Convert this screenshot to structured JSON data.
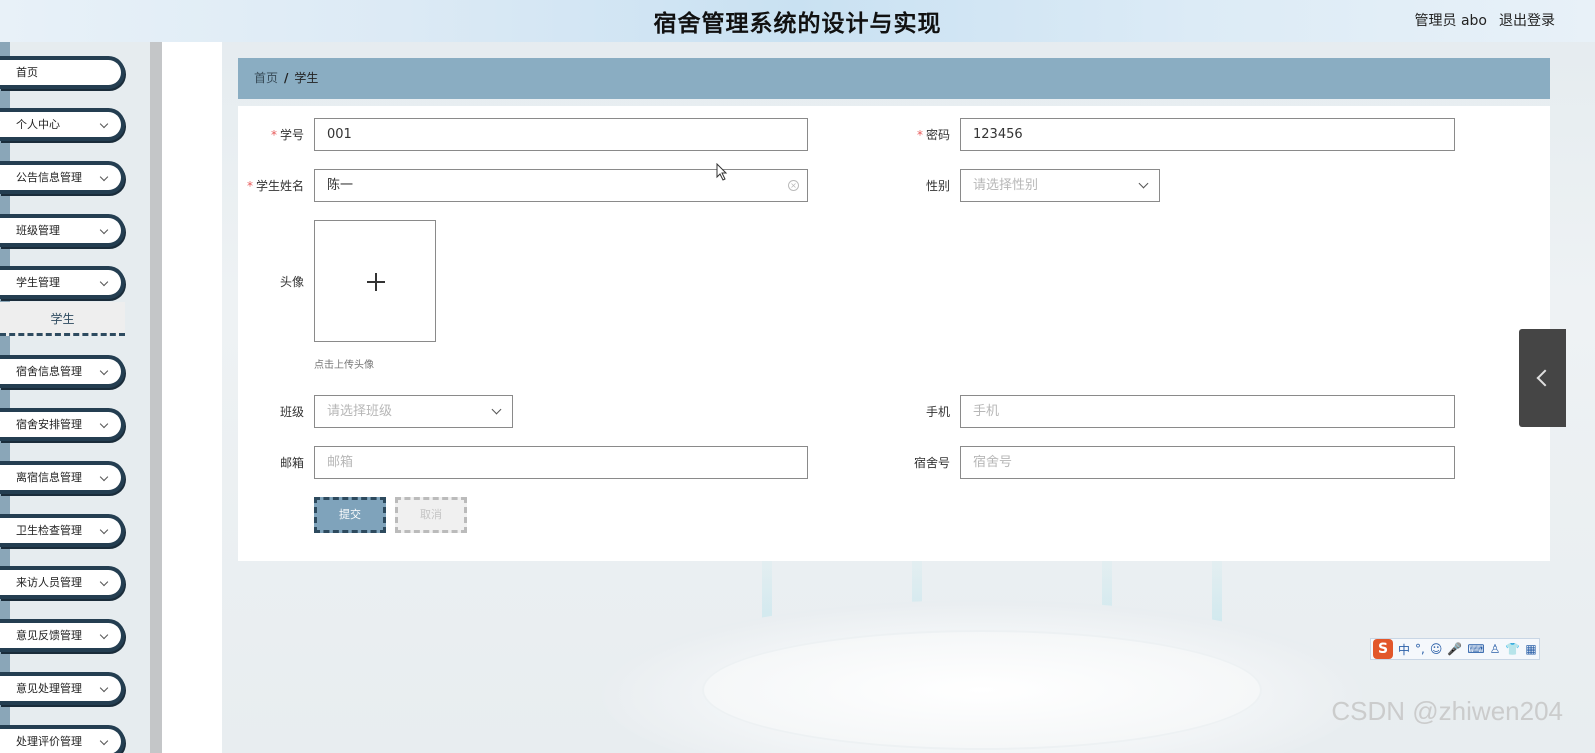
{
  "header": {
    "title": "宿舍管理系统的设计与实现",
    "user": "管理员 abo",
    "logout": "退出登录"
  },
  "sidebar": {
    "items": [
      {
        "label": "首页",
        "has_children": false
      },
      {
        "label": "个人中心",
        "has_children": true
      },
      {
        "label": "公告信息管理",
        "has_children": true
      },
      {
        "label": "班级管理",
        "has_children": true
      },
      {
        "label": "学生管理",
        "has_children": true
      },
      {
        "label": "宿舍信息管理",
        "has_children": true
      },
      {
        "label": "宿舍安排管理",
        "has_children": true
      },
      {
        "label": "离宿信息管理",
        "has_children": true
      },
      {
        "label": "卫生检查管理",
        "has_children": true
      },
      {
        "label": "来访人员管理",
        "has_children": true
      },
      {
        "label": "意见反馈管理",
        "has_children": true
      },
      {
        "label": "意见处理管理",
        "has_children": true
      },
      {
        "label": "处理评价管理",
        "has_children": true
      }
    ],
    "submenu_active": "学生"
  },
  "breadcrumb": {
    "home": "首页",
    "separator": "/",
    "current": "学生"
  },
  "form": {
    "student_no": {
      "label": "学号",
      "value": "001",
      "required": "*"
    },
    "password": {
      "label": "密码",
      "value": "123456",
      "required": "*"
    },
    "student_name": {
      "label": "学生姓名",
      "value": "陈一",
      "required": "*"
    },
    "gender": {
      "label": "性别",
      "placeholder": "请选择性别"
    },
    "avatar": {
      "label": "头像",
      "hint": "点击上传头像"
    },
    "class": {
      "label": "班级",
      "placeholder": "请选择班级"
    },
    "phone": {
      "label": "手机",
      "placeholder": "手机"
    },
    "email": {
      "label": "邮箱",
      "placeholder": "邮箱"
    },
    "dorm_no": {
      "label": "宿舍号",
      "placeholder": "宿舍号"
    },
    "submit": "提交",
    "cancel": "取消"
  },
  "ime": {
    "logo": "S",
    "mode": "中",
    "punct": "°,"
  },
  "watermark": "CSDN @zhiwen204"
}
